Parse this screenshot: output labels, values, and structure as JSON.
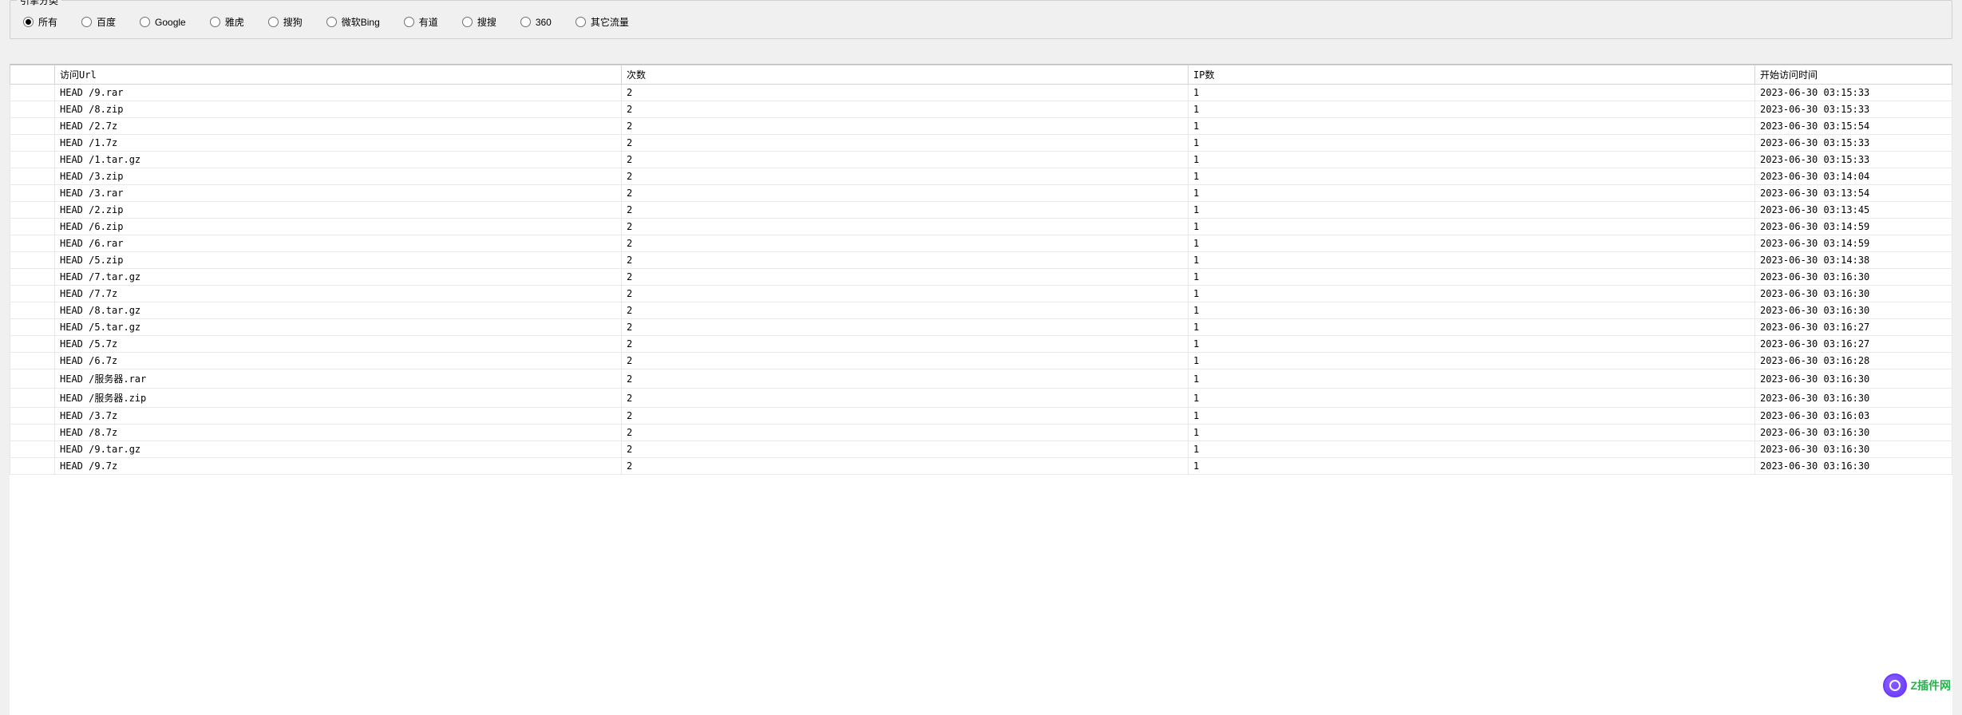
{
  "groupbox_title": "引擎分类",
  "radios": [
    {
      "label": "所有",
      "selected": true
    },
    {
      "label": "百度",
      "selected": false
    },
    {
      "label": "Google",
      "selected": false
    },
    {
      "label": "雅虎",
      "selected": false
    },
    {
      "label": "搜狗",
      "selected": false
    },
    {
      "label": "微软Bing",
      "selected": false
    },
    {
      "label": "有道",
      "selected": false
    },
    {
      "label": "搜搜",
      "selected": false
    },
    {
      "label": "360",
      "selected": false
    },
    {
      "label": "其它流量",
      "selected": false
    }
  ],
  "columns": {
    "blank": "",
    "url": "访问Url",
    "count": "次数",
    "ip": "IP数",
    "time": "开始访问时间"
  },
  "rows": [
    {
      "url": "HEAD /9.rar",
      "count": "2",
      "ip": "1",
      "time": "2023-06-30 03:15:33"
    },
    {
      "url": "HEAD /8.zip",
      "count": "2",
      "ip": "1",
      "time": "2023-06-30 03:15:33"
    },
    {
      "url": "HEAD /2.7z",
      "count": "2",
      "ip": "1",
      "time": "2023-06-30 03:15:54"
    },
    {
      "url": "HEAD /1.7z",
      "count": "2",
      "ip": "1",
      "time": "2023-06-30 03:15:33"
    },
    {
      "url": "HEAD /1.tar.gz",
      "count": "2",
      "ip": "1",
      "time": "2023-06-30 03:15:33"
    },
    {
      "url": "HEAD /3.zip",
      "count": "2",
      "ip": "1",
      "time": "2023-06-30 03:14:04"
    },
    {
      "url": "HEAD /3.rar",
      "count": "2",
      "ip": "1",
      "time": "2023-06-30 03:13:54"
    },
    {
      "url": "HEAD /2.zip",
      "count": "2",
      "ip": "1",
      "time": "2023-06-30 03:13:45"
    },
    {
      "url": "HEAD /6.zip",
      "count": "2",
      "ip": "1",
      "time": "2023-06-30 03:14:59"
    },
    {
      "url": "HEAD /6.rar",
      "count": "2",
      "ip": "1",
      "time": "2023-06-30 03:14:59"
    },
    {
      "url": "HEAD /5.zip",
      "count": "2",
      "ip": "1",
      "time": "2023-06-30 03:14:38"
    },
    {
      "url": "HEAD /7.tar.gz",
      "count": "2",
      "ip": "1",
      "time": "2023-06-30 03:16:30"
    },
    {
      "url": "HEAD /7.7z",
      "count": "2",
      "ip": "1",
      "time": "2023-06-30 03:16:30"
    },
    {
      "url": "HEAD /8.tar.gz",
      "count": "2",
      "ip": "1",
      "time": "2023-06-30 03:16:30"
    },
    {
      "url": "HEAD /5.tar.gz",
      "count": "2",
      "ip": "1",
      "time": "2023-06-30 03:16:27"
    },
    {
      "url": "HEAD /5.7z",
      "count": "2",
      "ip": "1",
      "time": "2023-06-30 03:16:27"
    },
    {
      "url": "HEAD /6.7z",
      "count": "2",
      "ip": "1",
      "time": "2023-06-30 03:16:28"
    },
    {
      "url": "HEAD /服务器.rar",
      "count": "2",
      "ip": "1",
      "time": "2023-06-30 03:16:30"
    },
    {
      "url": "HEAD /服务器.zip",
      "count": "2",
      "ip": "1",
      "time": "2023-06-30 03:16:30"
    },
    {
      "url": "HEAD /3.7z",
      "count": "2",
      "ip": "1",
      "time": "2023-06-30 03:16:03"
    },
    {
      "url": "HEAD /8.7z",
      "count": "2",
      "ip": "1",
      "time": "2023-06-30 03:16:30"
    },
    {
      "url": "HEAD /9.tar.gz",
      "count": "2",
      "ip": "1",
      "time": "2023-06-30 03:16:30"
    },
    {
      "url": "HEAD /9.7z",
      "count": "2",
      "ip": "1",
      "time": "2023-06-30 03:16:30"
    }
  ],
  "watermark": {
    "text": "Z插件网"
  }
}
